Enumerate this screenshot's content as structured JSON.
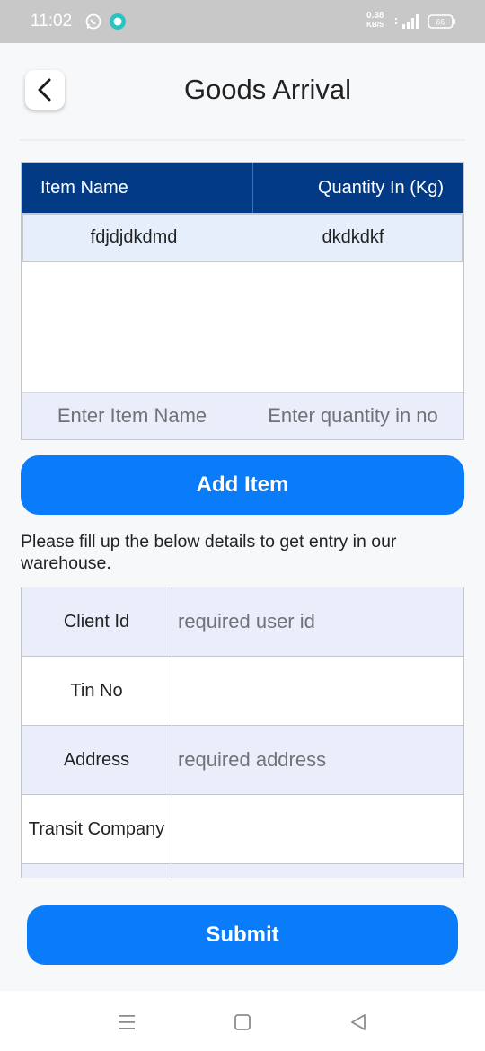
{
  "status_bar": {
    "time": "11:02",
    "net_speed_value": "0.38",
    "net_speed_unit": "KB/S",
    "battery_level": "66",
    "icons": [
      "whatsapp-icon",
      "message-icon",
      "signal-icon",
      "battery-icon"
    ]
  },
  "header": {
    "title": "Goods Arrival",
    "back_icon": "chevron-left-icon"
  },
  "items_table": {
    "columns": [
      "Item Name",
      "Quantity In (Kg)"
    ],
    "rows": [
      {
        "name": "fdjdjdkdmd",
        "quantity": "dkdkdkf"
      }
    ],
    "name_placeholder": "Enter Item Name",
    "quantity_placeholder": "Enter quantity in no"
  },
  "add_item_label": "Add Item",
  "info_text": "Please fill up the below details to get entry in our warehouse.",
  "form": {
    "fields": [
      {
        "label": "Client Id",
        "placeholder": "required user id"
      },
      {
        "label": "Tin No",
        "placeholder": ""
      },
      {
        "label": "Address",
        "placeholder": "required address"
      },
      {
        "label": "Transit Company",
        "placeholder": ""
      }
    ]
  },
  "submit_label": "Submit",
  "nav_bar": {
    "icons": [
      "menu-icon",
      "home-square-icon",
      "back-triangle-icon"
    ]
  },
  "colors": {
    "primary_button": "#0a7cf9",
    "table_header": "#033a86",
    "row_highlight": "#e9eefa",
    "status_bar": "#c8c8c8"
  }
}
